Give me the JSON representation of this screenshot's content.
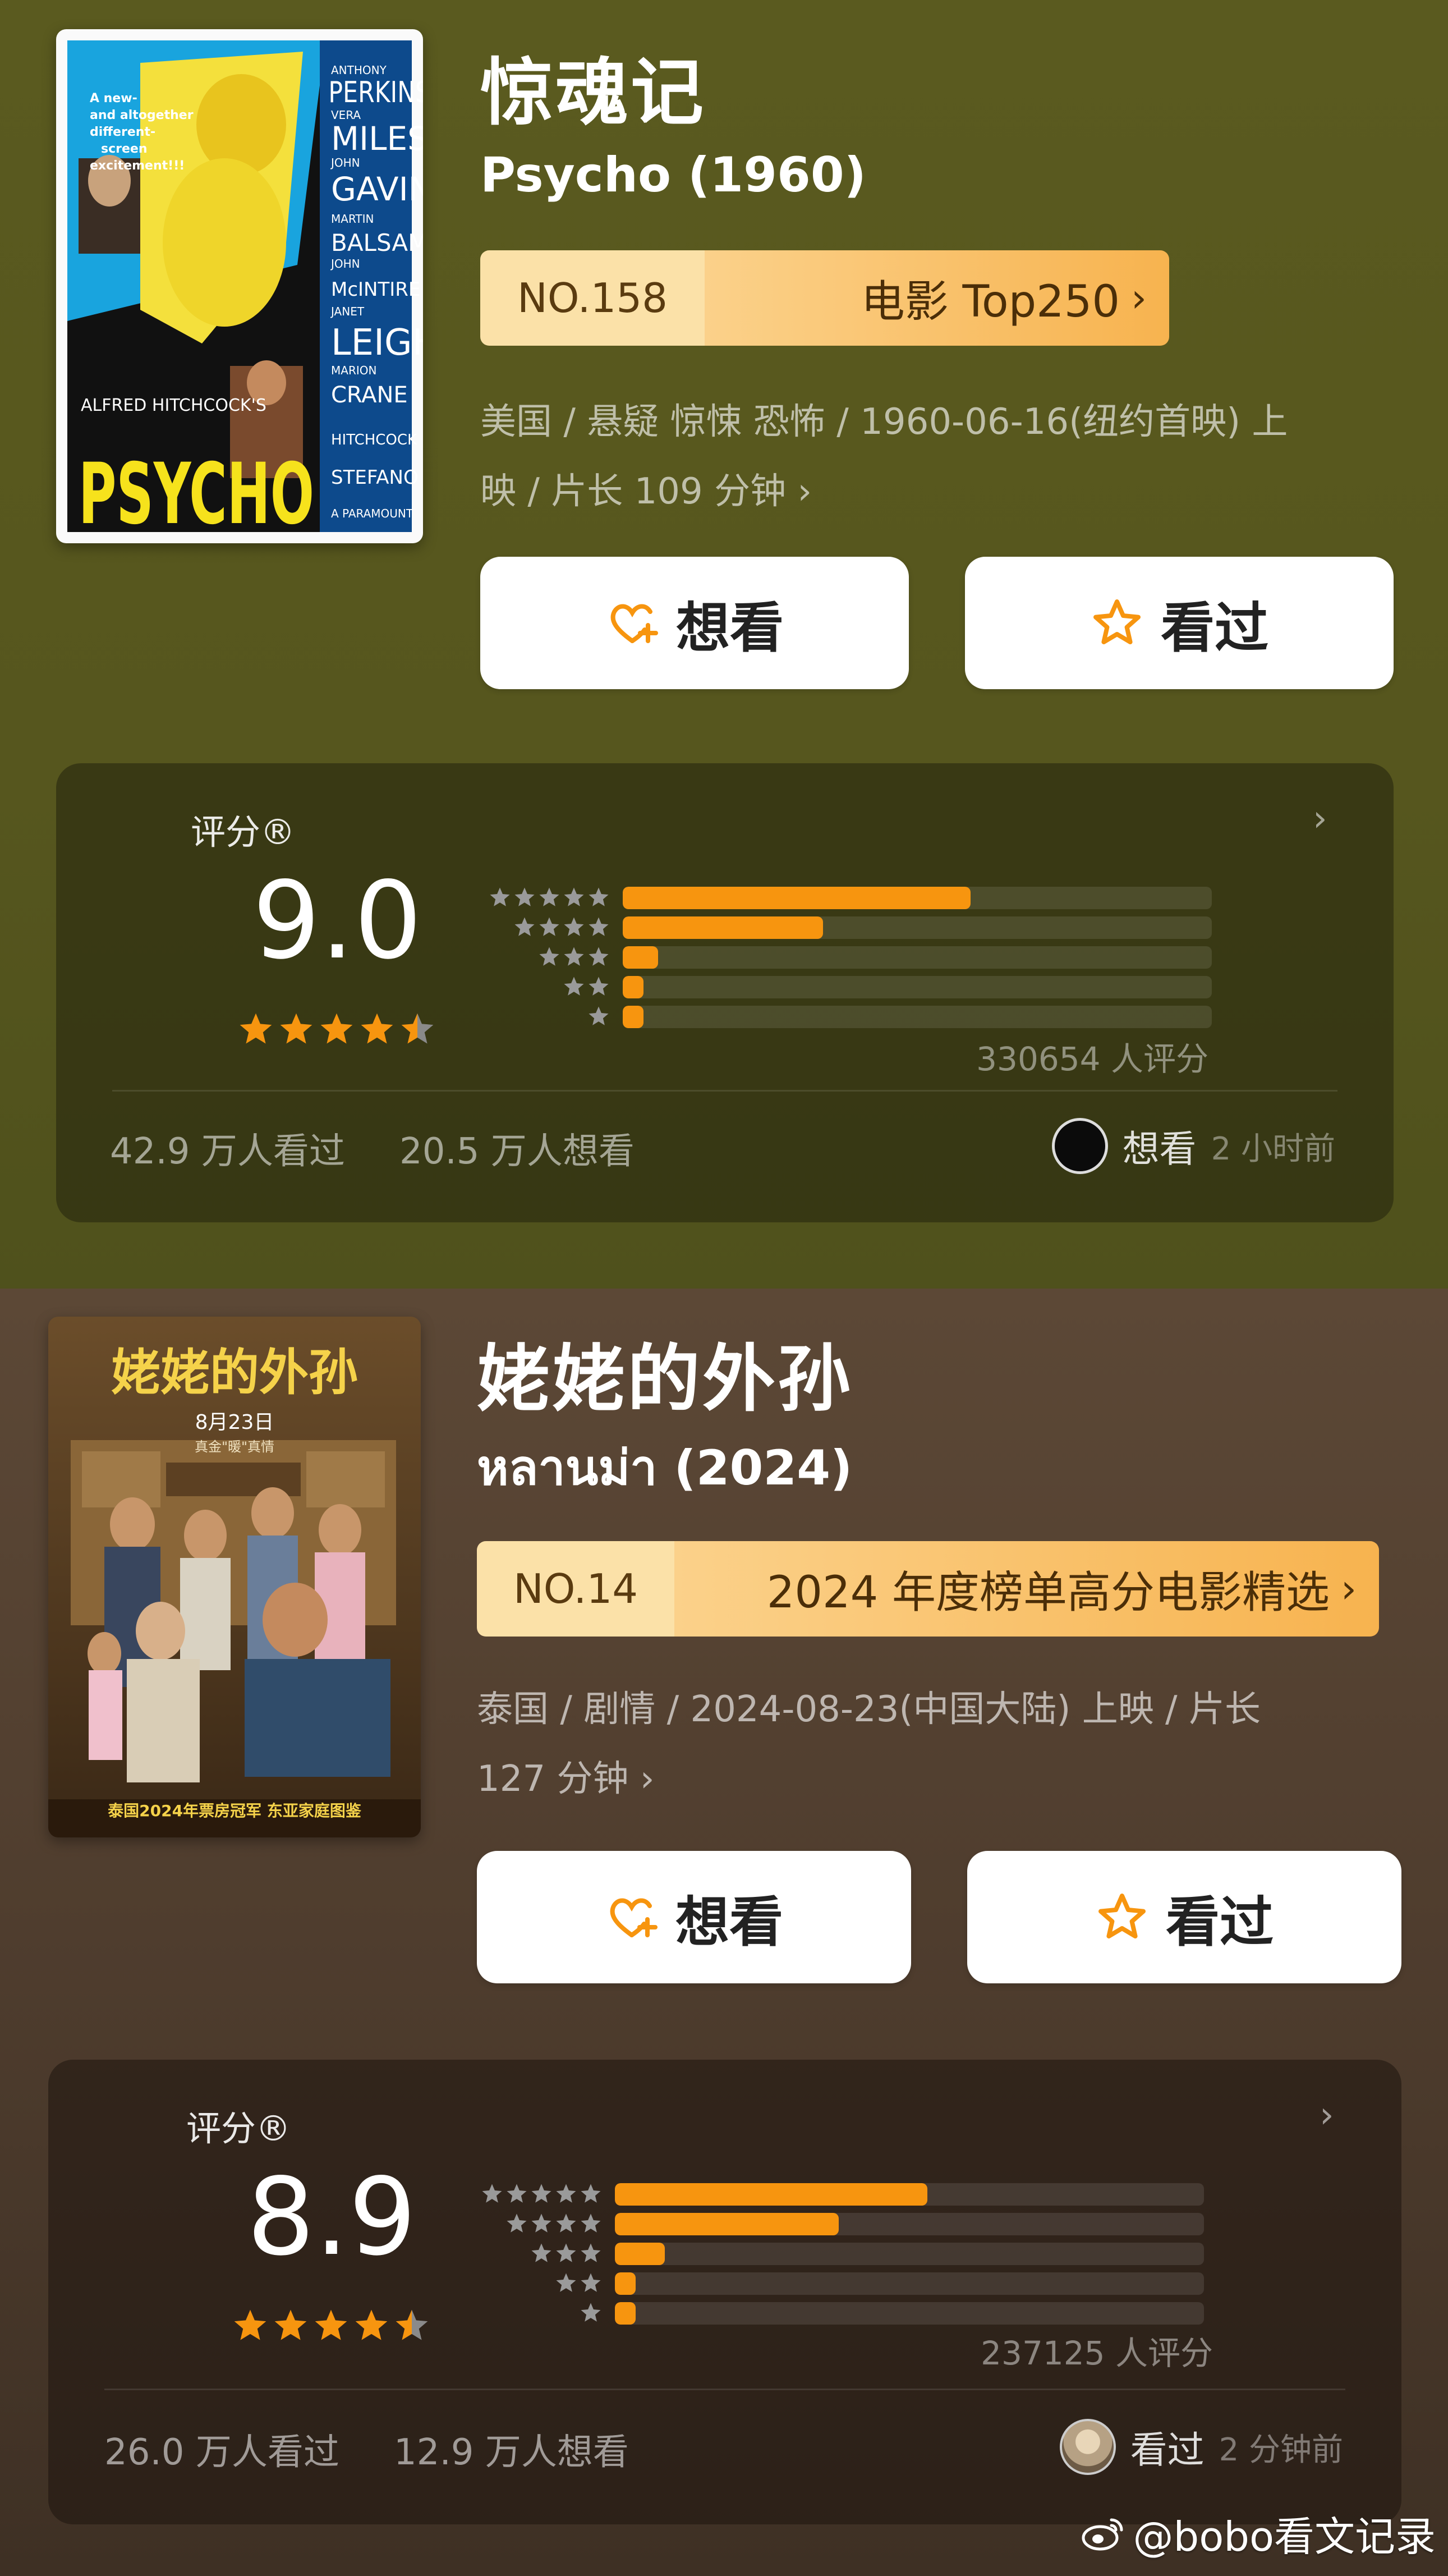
{
  "colors": {
    "accent": "#f7950f",
    "rank_gradient_end": "#f7b34f",
    "section1_bg": "#56561e",
    "section2_bg": "#4f3d2e"
  },
  "movies": [
    {
      "title_cn": "惊魂记",
      "title_orig": "Psycho (1960)",
      "rank": {
        "no": "NO.158",
        "list": "电影 Top250"
      },
      "meta": [
        "美国 / 悬疑 惊悚 恐怖 / 1960-06-16(纽约首映) 上",
        "映 / 片长 109 分钟"
      ],
      "poster": {
        "title": "PSYCHO",
        "director": "ALFRED HITCHCOCK'S",
        "tagline": [
          "A new-",
          "and altogether",
          "different-",
          "screen",
          "excitement!!!"
        ],
        "cast": [
          "ANTHONY",
          "PERKINS",
          "VERA",
          "MILES",
          "JOHN",
          "GAVIN",
          "MARTIN",
          "BALSAM",
          "JOHN",
          "McINTIRE",
          "JANET",
          "LEIGH",
          "MARION",
          "CRANE"
        ],
        "credits": [
          "HITCHCOCK",
          "STEFANO",
          "A PARAMOUNT"
        ]
      },
      "want_label": "想看",
      "seen_label": "看过",
      "rating": {
        "label": "评分®",
        "value": "9.0",
        "stars_out_of_5": 4.5,
        "distribution": [
          0.59,
          0.34,
          0.06,
          0.035,
          0.035
        ],
        "count": "330654 人评分"
      },
      "stats": {
        "seen": "42.9 万人看过",
        "want": "20.5 万人想看"
      },
      "user_status": {
        "label": "想看",
        "time": "2 小时前"
      }
    },
    {
      "title_cn": "姥姥的外孙",
      "title_orig": "หลานม่า (2024)",
      "rank": {
        "no": "NO.14",
        "list": "2024 年度榜单高分电影精选"
      },
      "meta": [
        "泰国 / 剧情 / 2024-08-23(中国大陆) 上映 / 片长",
        "127 分钟"
      ],
      "poster": {
        "title": "姥姥的外孙",
        "date": "8月23日",
        "subtitle": "真金\"暖\"真情",
        "footer": "泰国2024年票房冠军 东亚家庭图鉴"
      },
      "want_label": "想看",
      "seen_label": "看过",
      "rating": {
        "label": "评分®",
        "value": "8.9",
        "stars_out_of_5": 4.5,
        "distribution": [
          0.53,
          0.38,
          0.085,
          0.035,
          0.035
        ],
        "count": "237125 人评分"
      },
      "stats": {
        "seen": "26.0 万人看过",
        "want": "12.9 万人想看"
      },
      "user_status": {
        "label": "看过",
        "time": "2 分钟前"
      }
    }
  ],
  "watermark": "@bobo看文记录"
}
